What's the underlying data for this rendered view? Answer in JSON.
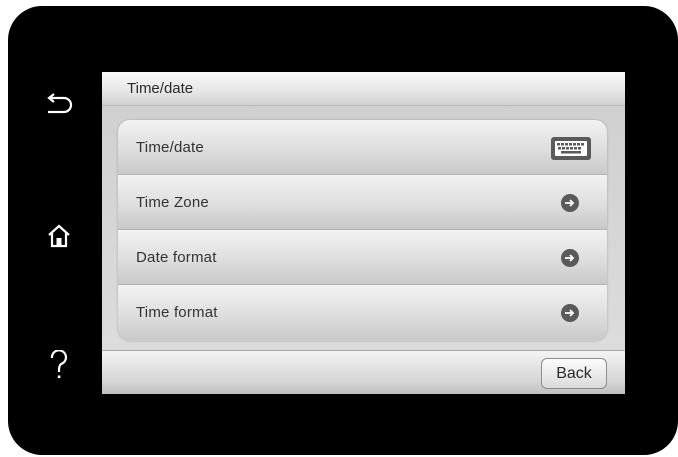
{
  "header": {
    "title": "Time/date"
  },
  "menu": {
    "items": [
      {
        "label": "Time/date",
        "icon": "keyboard-icon"
      },
      {
        "label": "Time Zone",
        "icon": "arrow-right-icon"
      },
      {
        "label": "Date format",
        "icon": "arrow-right-icon"
      },
      {
        "label": "Time format",
        "icon": "arrow-right-icon"
      }
    ]
  },
  "footer": {
    "back_label": "Back"
  },
  "side_buttons": [
    "back-icon",
    "home-icon",
    "help-icon"
  ],
  "colors": {
    "bezel": "#000000",
    "screen_bg": "#d7d7d7",
    "icon_dark": "#5a5a5a"
  }
}
